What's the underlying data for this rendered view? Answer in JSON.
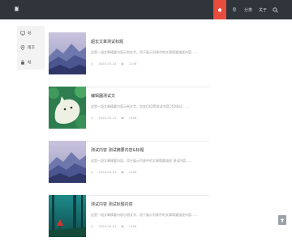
{
  "header": {
    "logo_icon": "broken-image-icon",
    "nav": [
      {
        "label": "",
        "icon": "home-icon",
        "active": true
      },
      {
        "label": "导",
        "icon": "",
        "active": false
      },
      {
        "label": "分类",
        "icon": "",
        "active": false
      },
      {
        "label": "关于",
        "icon": "",
        "active": false
      }
    ],
    "search_icon": "search-icon",
    "accent": "#e74c3c",
    "bg": "#2f353b"
  },
  "sidebar": {
    "items": [
      {
        "icon": "monitor-icon",
        "label": "站"
      },
      {
        "icon": "location-pin-icon",
        "label": "南京"
      },
      {
        "icon": "lock-icon",
        "label": "站"
      }
    ]
  },
  "posts": [
    {
      "title": "超长文章测试标题",
      "excerpt": "这是一段文章摘要内容示例文字，用于展示列表中的文章简要描述内容……",
      "date": "2020-05-14",
      "views": "1106",
      "thumb": "mountain-dusk"
    },
    {
      "title": "编辑器测试文",
      "excerpt": "这是一段文章摘要内容示例文字，包含C4D等测试内容C4D测试……",
      "date": "2020-05-14",
      "views": "1106",
      "thumb": "green-cat"
    },
    {
      "title": "测试内容 测试摘要内容&标题",
      "excerpt": "这是一段文章摘要内容，用于展示列表中的文章简要描述 测试内容……",
      "date": "2020-05-14",
      "views": "1106",
      "thumb": "mountain-dusk"
    },
    {
      "title": "测试内容 测试标题内容",
      "excerpt": "这是一段文章摘要内容示例文字，用于展示列表中的文章简要描述内容……",
      "date": "2020-05-14",
      "views": "1106",
      "thumb": "forest-red"
    }
  ],
  "scroll_top_icon": "arrow-up-icon"
}
